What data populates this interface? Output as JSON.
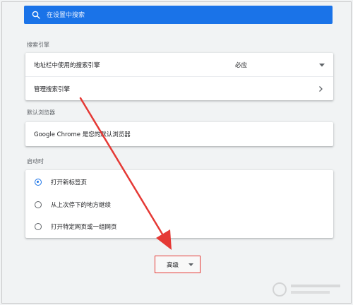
{
  "search": {
    "placeholder": "在设置中搜索",
    "icon": "search-icon"
  },
  "search_engine": {
    "title": "搜索引擎",
    "address_bar_label": "地址栏中使用的搜索引擎",
    "address_bar_value": "必应",
    "manage_label": "管理搜索引擎"
  },
  "default_browser": {
    "title": "默认浏览器",
    "status": "Google Chrome 是您的默认浏览器"
  },
  "on_startup": {
    "title": "启动时",
    "options": [
      {
        "label": "打开新标签页",
        "checked": true
      },
      {
        "label": "从上次停下的地方继续",
        "checked": false
      },
      {
        "label": "打开特定网页或一组网页",
        "checked": false
      }
    ]
  },
  "advanced": {
    "label": "高级",
    "icon": "caret-down-icon"
  },
  "colors": {
    "accent": "#1a73e8",
    "annotation": "#e53935"
  }
}
